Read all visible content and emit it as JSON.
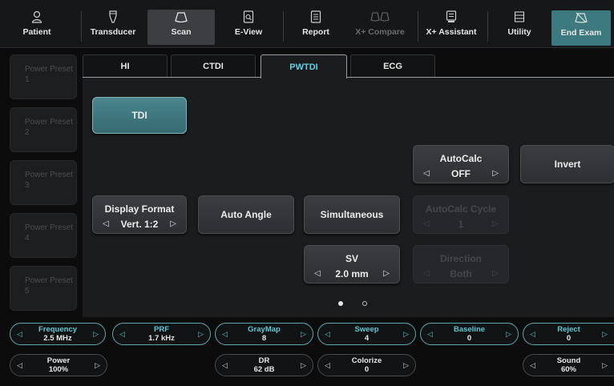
{
  "toolbar": {
    "patient": "Patient",
    "transducer": "Transducer",
    "scan": "Scan",
    "eview": "E-View",
    "report": "Report",
    "xcompare": "X+ Compare",
    "xassistant": "X+ Assistant",
    "utility": "Utility",
    "end_exam": "End Exam"
  },
  "presets": [
    "Power Preset 1",
    "Power Preset 2",
    "Power Preset 3",
    "Power Preset 4",
    "Power Preset 5"
  ],
  "tabs": [
    "HI",
    "CTDI",
    "PWTDI",
    "ECG"
  ],
  "active_tab": "PWTDI",
  "controls": {
    "tdi": "TDI",
    "display_format": {
      "label": "Display Format",
      "value": "Vert. 1:2"
    },
    "auto_angle": "Auto Angle",
    "simultaneous": "Simultaneous",
    "sv": {
      "label": "SV",
      "value": "2.0 mm"
    },
    "autocalc": {
      "label": "AutoCalc",
      "value": "OFF"
    },
    "invert": "Invert",
    "autocalc_cycle": {
      "label": "AutoCalc Cycle",
      "value": "1"
    },
    "direction": {
      "label": "Direction",
      "value": "Both"
    }
  },
  "pagination": {
    "current": 1,
    "total": 2
  },
  "knobs_row1": [
    {
      "label": "Frequency",
      "value": "2.5 MHz"
    },
    {
      "label": "PRF",
      "value": "1.7 kHz"
    },
    {
      "label": "GrayMap",
      "value": "8"
    },
    {
      "label": "Sweep",
      "value": "4"
    },
    {
      "label": "Baseline",
      "value": "0"
    },
    {
      "label": "Reject",
      "value": "0"
    }
  ],
  "knobs_row2": [
    {
      "label": "Power",
      "value": "100%"
    },
    {
      "label": "DR",
      "value": "62 dB"
    },
    {
      "label": "Colorize",
      "value": "0"
    },
    {
      "label": "Sound",
      "value": "60%"
    }
  ],
  "colors": {
    "accent": "#5fd0e3",
    "teal_button": "#3c7a80",
    "background": "#0c0c0d"
  }
}
